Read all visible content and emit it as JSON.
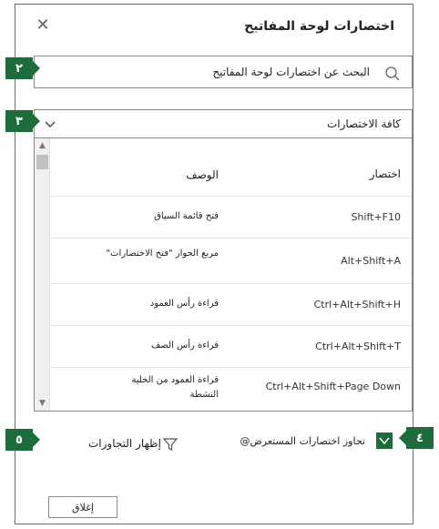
{
  "dialog": {
    "title": "اختصارات لوحة المفاتيح",
    "close_glyph": "✕"
  },
  "search": {
    "placeholder": "البحث عن اختصارات لوحة المفاتيح",
    "badge": "٢"
  },
  "category": {
    "selected": "كافة الاختصارات",
    "badge": "٣"
  },
  "table": {
    "headers": {
      "shortcut": "اختصار",
      "description": "الوصف"
    },
    "rows": [
      {
        "shortcut": "Shift+F10",
        "description": "فتح قائمة السياق"
      },
      {
        "shortcut": "Alt+Shift+A",
        "description": "مربع الحوار \"فتح الاختصارات\""
      },
      {
        "shortcut": "Ctrl+Alt+Shift+H",
        "description": "قراءة رأس العمود"
      },
      {
        "shortcut": "Ctrl+Alt+Shift+T",
        "description": "قراءة رأس الصف"
      },
      {
        "shortcut": "Ctrl+Alt+Shift+Page Down",
        "description": "قراءة العمود من الخلية النشطة"
      }
    ]
  },
  "footer": {
    "override_label": "تجاوز اختصارات المستعرض@",
    "override_badge": "٤",
    "override_checked": true,
    "show_overrides": "إظهار التجاوزات",
    "show_overrides_badge": "٥",
    "close_button": "إغلاق"
  },
  "icons": {
    "search": "search-icon",
    "filter": "filter-icon",
    "chevron": "chevron-down-icon",
    "close": "close-icon"
  },
  "colors": {
    "accent": "#1e6b3c"
  }
}
